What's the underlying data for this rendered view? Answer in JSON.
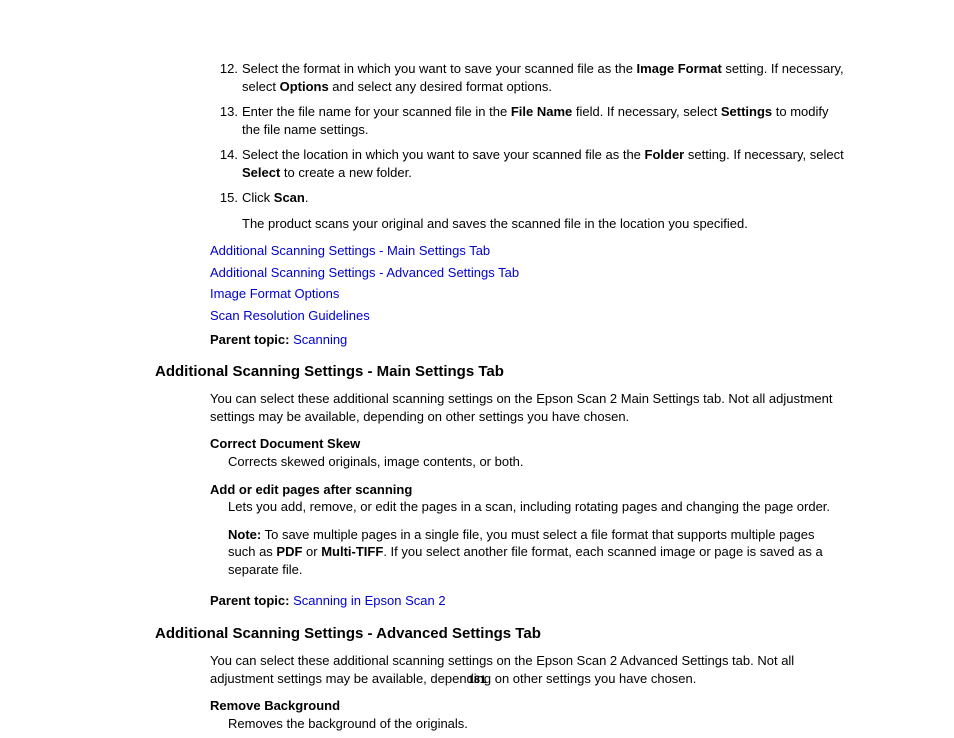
{
  "steps": [
    {
      "num": "12.",
      "parts": [
        {
          "t": "Select the format in which you want to save your scanned file as the "
        },
        {
          "t": "Image Format",
          "b": true
        },
        {
          "t": " setting. If necessary, select "
        },
        {
          "t": "Options",
          "b": true
        },
        {
          "t": " and select any desired format options."
        }
      ]
    },
    {
      "num": "13.",
      "parts": [
        {
          "t": "Enter the file name for your scanned file in the "
        },
        {
          "t": "File Name",
          "b": true
        },
        {
          "t": " field. If necessary, select "
        },
        {
          "t": "Settings",
          "b": true
        },
        {
          "t": " to modify the file name settings."
        }
      ]
    },
    {
      "num": "14.",
      "parts": [
        {
          "t": "Select the location in which you want to save your scanned file as the "
        },
        {
          "t": "Folder",
          "b": true
        },
        {
          "t": " setting. If necessary, select "
        },
        {
          "t": "Select",
          "b": true
        },
        {
          "t": " to create a new folder."
        }
      ]
    },
    {
      "num": "15.",
      "parts": [
        {
          "t": "Click "
        },
        {
          "t": "Scan",
          "b": true
        },
        {
          "t": "."
        }
      ]
    }
  ],
  "afterStepsText": "The product scans your original and saves the scanned file in the location you specified.",
  "links": [
    "Additional Scanning Settings - Main Settings Tab",
    "Additional Scanning Settings - Advanced Settings Tab",
    "Image Format Options",
    "Scan Resolution Guidelines"
  ],
  "parentTopic1": {
    "label": "Parent topic: ",
    "value": "Scanning"
  },
  "section1": {
    "title": "Additional Scanning Settings - Main Settings Tab",
    "intro": "You can select these additional scanning settings on the Epson Scan 2 Main Settings tab. Not all adjustment settings may be available, depending on other settings you have chosen.",
    "defs": [
      {
        "term": "Correct Document Skew",
        "desc": "Corrects skewed originals, image contents, or both."
      },
      {
        "term": "Add or edit pages after scanning",
        "desc": "Lets you add, remove, or edit the pages in a scan, including rotating pages and changing the page order."
      }
    ],
    "note": {
      "label": "Note:",
      "parts": [
        {
          "t": " To save multiple pages in a single file, you must select a file format that supports multiple pages such as "
        },
        {
          "t": "PDF",
          "b": true
        },
        {
          "t": " or "
        },
        {
          "t": "Multi-TIFF",
          "b": true
        },
        {
          "t": ". If you select another file format, each scanned image or page is saved as a separate file."
        }
      ]
    },
    "parentTopic": {
      "label": "Parent topic: ",
      "value": "Scanning in Epson Scan 2"
    }
  },
  "section2": {
    "title": "Additional Scanning Settings - Advanced Settings Tab",
    "intro": "You can select these additional scanning settings on the Epson Scan 2 Advanced Settings tab. Not all adjustment settings may be available, depending on other settings you have chosen.",
    "defs": [
      {
        "term": "Remove Background",
        "desc": "Removes the background of the originals."
      }
    ]
  },
  "pageNumber": "181"
}
